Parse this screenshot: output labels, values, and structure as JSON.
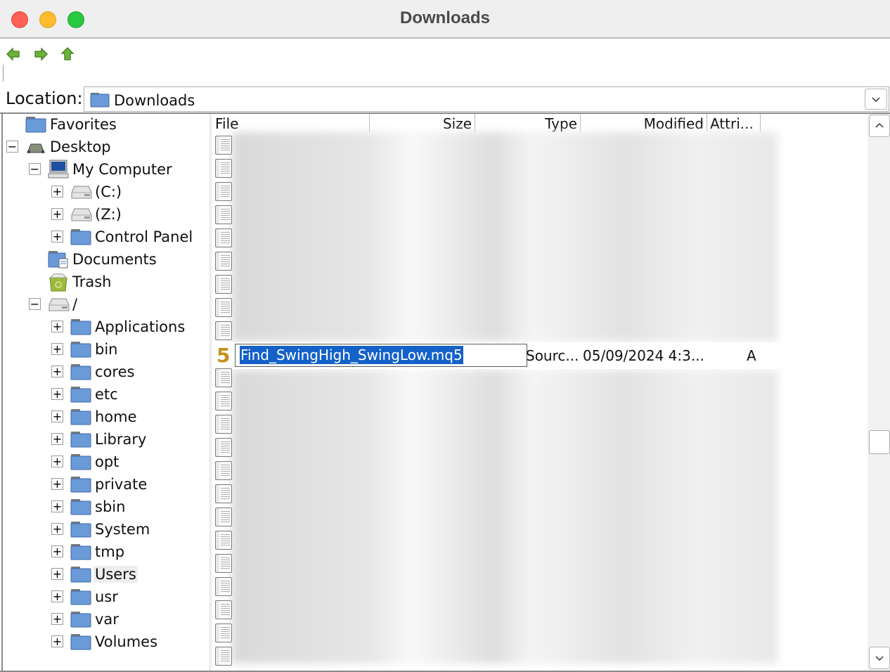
{
  "window": {
    "title": "Downloads",
    "controls": [
      "close",
      "minimize",
      "maximize"
    ]
  },
  "toolbar": {
    "buttons": [
      {
        "name": "back",
        "icon": "arrow-left-icon"
      },
      {
        "name": "forward",
        "icon": "arrow-right-icon"
      },
      {
        "name": "up",
        "icon": "arrow-up-icon"
      }
    ]
  },
  "location": {
    "label": "Location:",
    "value": "Downloads",
    "icon": "folder-icon"
  },
  "tree": {
    "items": [
      {
        "label": "Favorites",
        "icon": "folder-icon",
        "level": 0,
        "expander": null
      },
      {
        "label": "Desktop",
        "icon": "desktop-icon",
        "level": 0,
        "expander": "−"
      },
      {
        "label": "My Computer",
        "icon": "computer-icon",
        "level": 1,
        "expander": "−"
      },
      {
        "label": "(C:)",
        "icon": "drive-icon",
        "level": 2,
        "expander": "+"
      },
      {
        "label": "(Z:)",
        "icon": "drive-icon",
        "level": 2,
        "expander": "+"
      },
      {
        "label": "Control Panel",
        "icon": "folder-icon",
        "level": 2,
        "expander": "+"
      },
      {
        "label": "Documents",
        "icon": "documents-icon",
        "level": 1,
        "expander": null
      },
      {
        "label": "Trash",
        "icon": "trash-icon",
        "level": 1,
        "expander": null
      },
      {
        "label": "/",
        "icon": "drive-icon",
        "level": 1,
        "expander": "−"
      },
      {
        "label": "Applications",
        "icon": "folder-icon",
        "level": 2,
        "expander": "+"
      },
      {
        "label": "bin",
        "icon": "folder-icon",
        "level": 2,
        "expander": "+"
      },
      {
        "label": "cores",
        "icon": "folder-icon",
        "level": 2,
        "expander": "+"
      },
      {
        "label": "etc",
        "icon": "folder-icon",
        "level": 2,
        "expander": "+"
      },
      {
        "label": "home",
        "icon": "folder-icon",
        "level": 2,
        "expander": "+"
      },
      {
        "label": "Library",
        "icon": "folder-icon",
        "level": 2,
        "expander": "+"
      },
      {
        "label": "opt",
        "icon": "folder-icon",
        "level": 2,
        "expander": "+"
      },
      {
        "label": "private",
        "icon": "folder-icon",
        "level": 2,
        "expander": "+"
      },
      {
        "label": "sbin",
        "icon": "folder-icon",
        "level": 2,
        "expander": "+"
      },
      {
        "label": "System",
        "icon": "folder-icon",
        "level": 2,
        "expander": "+"
      },
      {
        "label": "tmp",
        "icon": "folder-icon",
        "level": 2,
        "expander": "+"
      },
      {
        "label": "Users",
        "icon": "folder-icon",
        "level": 2,
        "expander": "+",
        "hover": true
      },
      {
        "label": "usr",
        "icon": "folder-icon",
        "level": 2,
        "expander": "+"
      },
      {
        "label": "var",
        "icon": "folder-icon",
        "level": 2,
        "expander": "+"
      },
      {
        "label": "Volumes",
        "icon": "folder-icon",
        "level": 2,
        "expander": "+"
      }
    ]
  },
  "filelist": {
    "columns": [
      "File",
      "Size",
      "Type",
      "Modified",
      "Attri..."
    ],
    "blurred_rows_above": 9,
    "blurred_rows_below": 13,
    "selected_row": {
      "icon": "mq5-file-icon",
      "icon_glyph": "5",
      "name": "Find_SwingHigh_SwingLow.mq5",
      "type": "Sourc...",
      "modified": "05/09/2024 4:3...",
      "attributes": "A",
      "editing": true
    }
  },
  "colors": {
    "selection": "#1461c9",
    "mq5_icon": "#c8901c",
    "folder_blue": "#6a9ad8"
  }
}
